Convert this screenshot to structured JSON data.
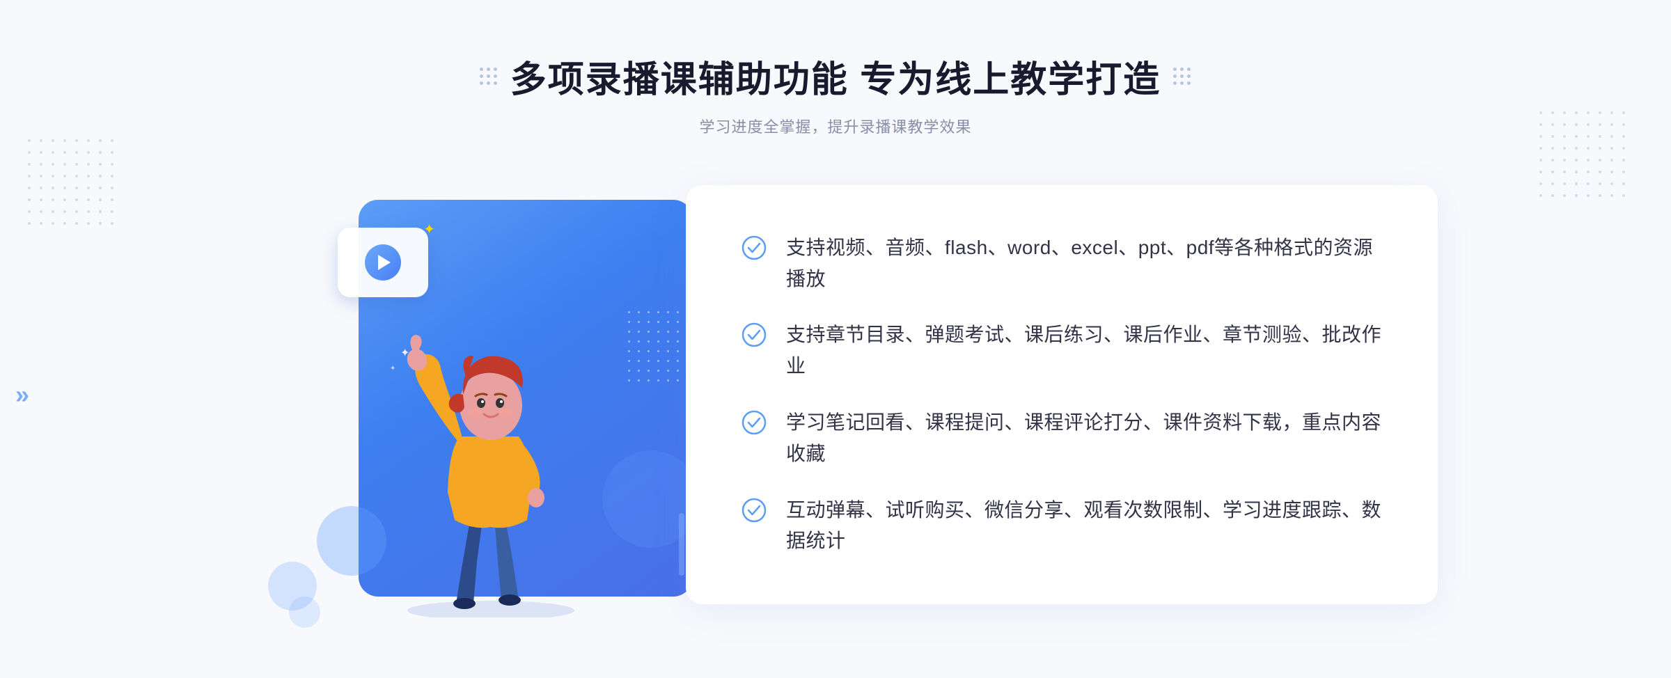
{
  "header": {
    "title": "多项录播课辅助功能 专为线上教学打造",
    "subtitle": "学习进度全掌握，提升录播课教学效果"
  },
  "features": [
    {
      "id": 1,
      "text": "支持视频、音频、flash、word、excel、ppt、pdf等各种格式的资源播放"
    },
    {
      "id": 2,
      "text": "支持章节目录、弹题考试、课后练习、课后作业、章节测验、批改作业"
    },
    {
      "id": 3,
      "text": "学习笔记回看、课程提问、课程评论打分、课件资料下载，重点内容收藏"
    },
    {
      "id": 4,
      "text": "互动弹幕、试听购买、微信分享、观看次数限制、学习进度跟踪、数据统计"
    }
  ],
  "colors": {
    "accent_blue": "#4a7ef5",
    "light_blue": "#7ab3ff",
    "text_dark": "#333348",
    "text_gray": "#888ea8",
    "check_color": "#5b9df7"
  }
}
